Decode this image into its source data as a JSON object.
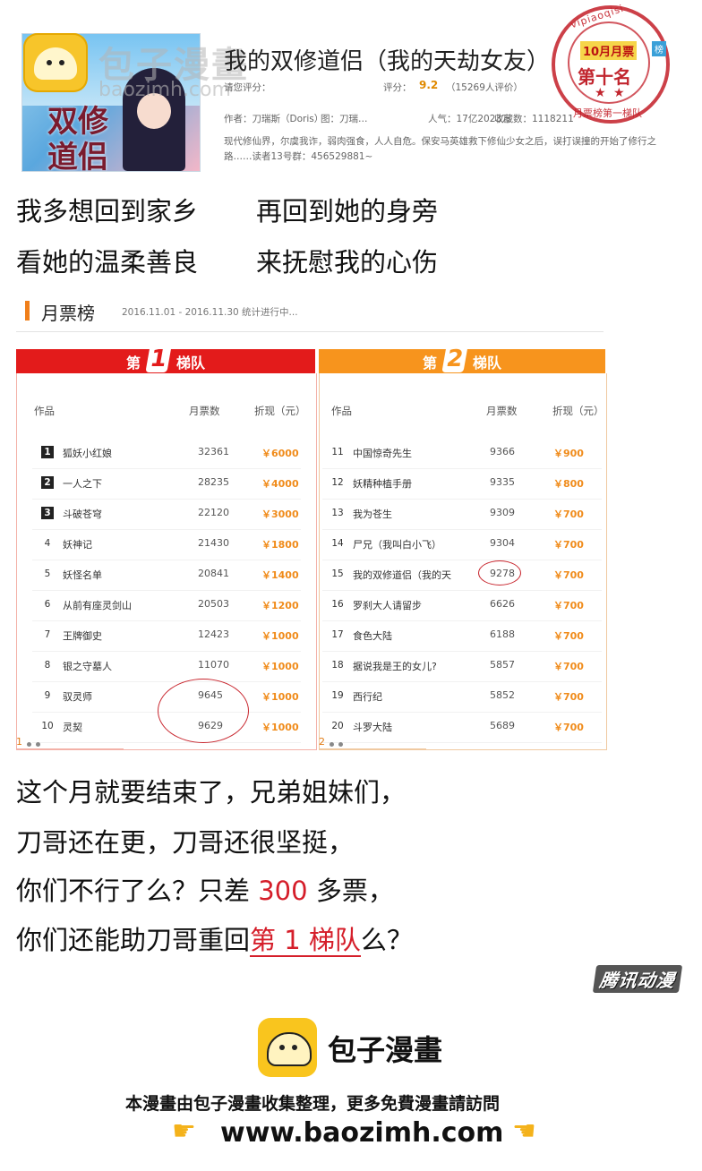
{
  "watermark": {
    "name": "包子漫畫",
    "url": "baozimh.com"
  },
  "book": {
    "cover_text": "双修道侣",
    "title": "我的双修道侣（我的天劫女友）",
    "rating_label": "请您评分：",
    "score_label": "评分：",
    "score": "9.2",
    "score_count": "（15269人评价）",
    "author": "作者：刀瑞斯（Doris）",
    "artist": "图：刀瑞…",
    "popularity": "人气：17亿2023万",
    "favorites": "收藏数：1118211",
    "desc_line1": "现代修仙界，尔虞我诈，弱肉强食，人人自危。保安马英雄救下修仙少女之后，误打误撞的开始了修行之",
    "desc_line2": "路……读者13号群：456529881~"
  },
  "stamp": {
    "top_text": "vipiaoqisi",
    "month": "10月月票",
    "badge": "榜",
    "rank": "第十名",
    "stars": "★ ★",
    "bottom_text": "月票榜第一梯队"
  },
  "lyrics": {
    "line1a": "我多想回到家乡",
    "line1b": "再回到她的身旁",
    "line2a": "看她的温柔善良",
    "line2b": "来抚慰我的心伤"
  },
  "ranking": {
    "title": "月票榜",
    "period": "2016.11.01 - 2016.11.30 统计进行中...",
    "tier1": {
      "prefix": "第",
      "num": "1",
      "suffix": "梯队"
    },
    "tier2": {
      "prefix": "第",
      "num": "2",
      "suffix": "梯队"
    },
    "headers": {
      "work": "作品",
      "votes": "月票数",
      "cash": "折现（元）"
    },
    "tier1_rows": [
      {
        "no": "1",
        "name": "狐妖小红娘",
        "votes": "32361",
        "cash": "￥6000"
      },
      {
        "no": "2",
        "name": "一人之下",
        "votes": "28235",
        "cash": "￥4000"
      },
      {
        "no": "3",
        "name": "斗破苍穹",
        "votes": "22120",
        "cash": "￥3000"
      },
      {
        "no": "4",
        "name": "妖神记",
        "votes": "21430",
        "cash": "￥1800"
      },
      {
        "no": "5",
        "name": "妖怪名单",
        "votes": "20841",
        "cash": "￥1400"
      },
      {
        "no": "6",
        "name": "从前有座灵剑山",
        "votes": "20503",
        "cash": "￥1200"
      },
      {
        "no": "7",
        "name": "王牌御史",
        "votes": "12423",
        "cash": "￥1000"
      },
      {
        "no": "8",
        "name": "银之守墓人",
        "votes": "11070",
        "cash": "￥1000"
      },
      {
        "no": "9",
        "name": "驭灵师",
        "votes": "9645",
        "cash": "￥1000"
      },
      {
        "no": "10",
        "name": "灵契",
        "votes": "9629",
        "cash": "￥1000"
      }
    ],
    "tier2_rows": [
      {
        "no": "11",
        "name": "中国惊奇先生",
        "votes": "9366",
        "cash": "￥900"
      },
      {
        "no": "12",
        "name": "妖精种植手册",
        "votes": "9335",
        "cash": "￥800"
      },
      {
        "no": "13",
        "name": "我为苍生",
        "votes": "9309",
        "cash": "￥700"
      },
      {
        "no": "14",
        "name": "尸兄（我叫白小飞）",
        "votes": "9304",
        "cash": "￥700"
      },
      {
        "no": "15",
        "name": "我的双修道侣（我的天",
        "votes": "9278",
        "cash": "￥700"
      },
      {
        "no": "16",
        "name": "罗刹大人请留步",
        "votes": "6626",
        "cash": "￥700"
      },
      {
        "no": "17",
        "name": "食色大陆",
        "votes": "6188",
        "cash": "￥700"
      },
      {
        "no": "18",
        "name": "据说我是王的女儿?",
        "votes": "5857",
        "cash": "￥700"
      },
      {
        "no": "19",
        "name": "西行纪",
        "votes": "5852",
        "cash": "￥700"
      },
      {
        "no": "20",
        "name": "斗罗大陆",
        "votes": "5689",
        "cash": "￥700"
      }
    ],
    "page1": "1",
    "page2": "2"
  },
  "commentary": {
    "line1": "这个月就要结束了，兄弟姐妹们，",
    "line2": "刀哥还在更，刀哥还很坚挺，",
    "line3_pre": "你们不行了么？只差",
    "line3_num": "300",
    "line3_post": "多票，",
    "line4_pre": "你们还能助刀哥重回",
    "line4_red": "第 1 梯队",
    "line4_post": "么？"
  },
  "tencent_mark": "腾讯动漫",
  "footer": {
    "brand": "包子漫畫",
    "note": "本漫畫由包子漫畫收集整理，更多免費漫畫請訪問",
    "url": "www.baozimh.com"
  },
  "colors": {
    "tier1": "#e31b1b",
    "tier2": "#f7941d",
    "highlight": "#d51e2a",
    "cash": "#f08b1a"
  }
}
